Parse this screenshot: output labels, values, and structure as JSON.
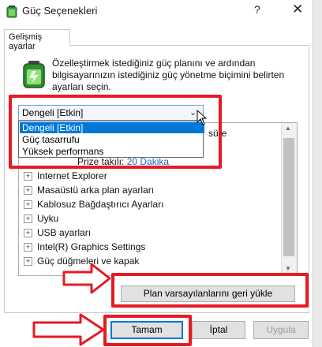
{
  "window": {
    "title": "Güç Seçenekleri",
    "help_glyph": "?",
    "close_glyph": "✕"
  },
  "tab": {
    "label": "Gelişmiş ayarlar"
  },
  "description": "Özelleştirmek istediğiniz güç planını ve ardından bilgisayarınızın istediğiniz güç yönetme biçimini belirten ayarları seçin.",
  "plan_combo": {
    "selected": "Dengeli [Etkin]",
    "options": [
      "Dengeli [Etkin]",
      "Güç tasarrufu",
      "Yüksek performans"
    ]
  },
  "tree": {
    "partial_text": "süre",
    "sub_label": "Prize takılı:",
    "sub_value": "20 Dakika",
    "items": [
      "Internet Explorer",
      "Masaüstü arka plan ayarları",
      "Kablosuz Bağdaştırıcı Ayarları",
      "Uyku",
      "USB ayarları",
      "Intel(R) Graphics Settings",
      "Güç düğmeleri ve kapak"
    ]
  },
  "buttons": {
    "restore": "Plan varsayılanlarını geri yükle",
    "ok": "Tamam",
    "cancel": "İptal",
    "apply": "Uygula"
  },
  "colors": {
    "accent": "#0078d7",
    "annotation_red": "#e51b24",
    "link_blue": "#1a66c2"
  },
  "icons": {
    "window": "battery-icon",
    "battery": "battery-icon",
    "cursor": "mouse-cursor-icon"
  }
}
